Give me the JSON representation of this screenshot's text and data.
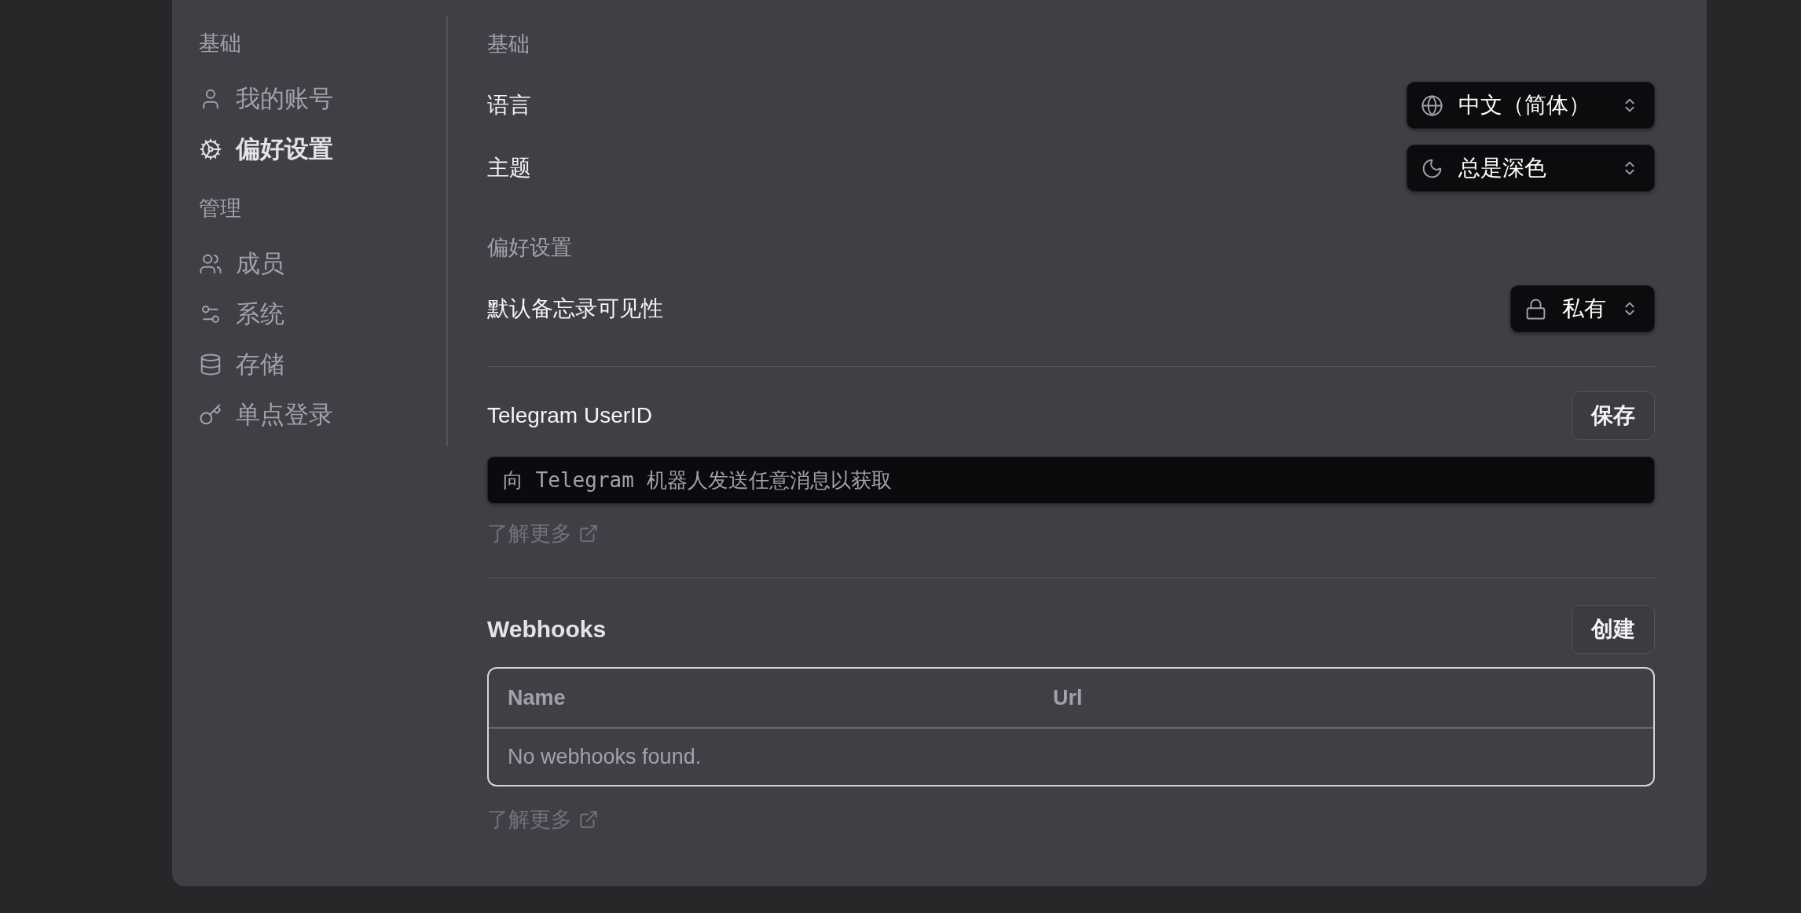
{
  "sidebar": {
    "sections": [
      {
        "title": "基础",
        "items": [
          {
            "label": "我的账号",
            "selected": false
          },
          {
            "label": "偏好设置",
            "selected": true
          }
        ]
      },
      {
        "title": "管理",
        "items": [
          {
            "label": "成员",
            "selected": false
          },
          {
            "label": "系统",
            "selected": false
          },
          {
            "label": "存储",
            "selected": false
          },
          {
            "label": "单点登录",
            "selected": false
          }
        ]
      }
    ]
  },
  "sections": [
    {
      "title": "基础",
      "settings": [
        {
          "label": "语言",
          "value": "中文（简体）"
        },
        {
          "label": "主题",
          "value": "总是深色"
        }
      ]
    },
    {
      "title": "偏好设置",
      "settings": [
        {
          "label": "默认备忘录可见性",
          "value": "私有"
        }
      ]
    }
  ],
  "telegram": {
    "label": "Telegram UserID",
    "button": "保存",
    "input": {
      "placeholder": "向 Telegram 机器人发送任意消息以获取"
    },
    "link": "了解更多"
  },
  "webhooks": {
    "title": "Webhooks",
    "button": "创建",
    "table": {
      "columns": [
        "Name",
        "Url"
      ],
      "empty_message": "No webhooks found."
    },
    "link": "了解更多"
  }
}
